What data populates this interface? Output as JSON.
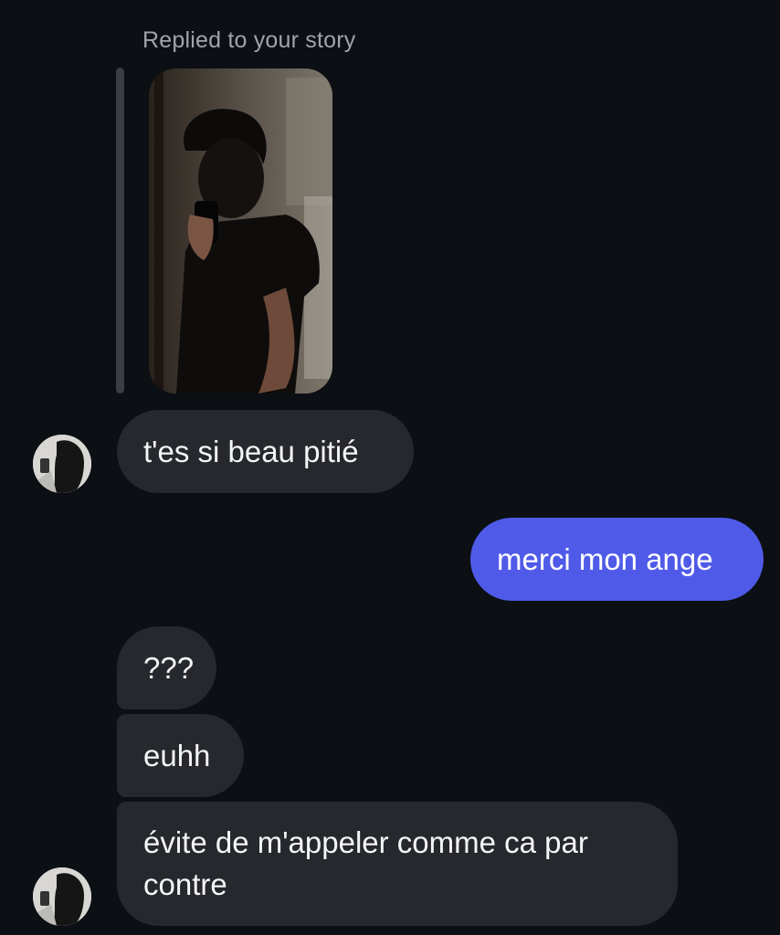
{
  "story_reply": {
    "label": "Replied to your story",
    "thumbnail_icon": "story-photo-mirror-selfie"
  },
  "messages": [
    {
      "direction": "incoming",
      "text": "t'es si beau pitié",
      "avatar": "contact-avatar"
    },
    {
      "direction": "outgoing",
      "text": "merci mon ange"
    },
    {
      "direction": "incoming",
      "text": "???"
    },
    {
      "direction": "incoming",
      "text": "euhh"
    },
    {
      "direction": "incoming",
      "text": "évite de m'appeler comme ca par contre",
      "avatar": "contact-avatar"
    }
  ],
  "colors": {
    "background": "#0c0f14",
    "incoming_bubble": "#26282d",
    "outgoing_bubble": "#4f5be8",
    "reply_label": "#a1a4ab"
  }
}
